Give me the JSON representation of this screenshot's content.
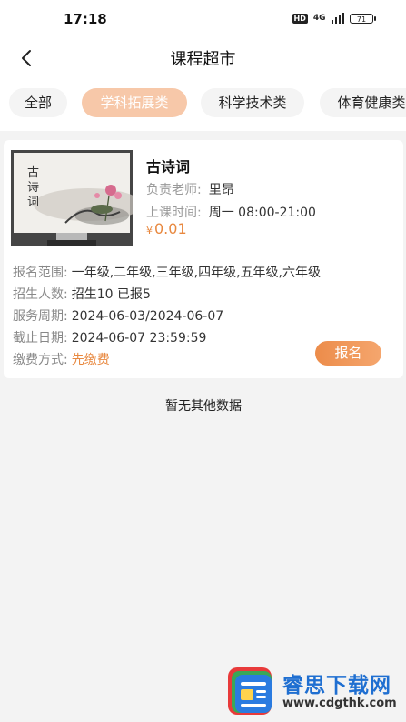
{
  "status_bar": {
    "time": "17:18",
    "network_badge": "HD",
    "wifi_label": "4G",
    "battery": "71"
  },
  "header": {
    "title": "课程超市",
    "back_icon": "chevron-left-icon"
  },
  "tabs": [
    {
      "label": "全部",
      "active": false
    },
    {
      "label": "学科拓展类",
      "active": true
    },
    {
      "label": "科学技术类",
      "active": false
    },
    {
      "label": "体育健康类",
      "active": false
    }
  ],
  "course": {
    "image_text": "古诗词",
    "name": "古诗词",
    "teacher_label": "负责老师:",
    "teacher": "里昂",
    "time_label": "上课时间:",
    "time": "周一 08:00-21:00",
    "price_symbol": "¥",
    "price": "0.01",
    "details": [
      {
        "label": "报名范围:",
        "value": "一年级,二年级,三年级,四年级,五年级,六年级"
      },
      {
        "label": "招生人数:",
        "value": "招生10 已报5"
      },
      {
        "label": "服务周期:",
        "value": "2024-06-03/2024-06-07"
      },
      {
        "label": "截止日期:",
        "value": "2024-06-07 23:59:59"
      },
      {
        "label": "缴费方式:",
        "value": "先缴费"
      }
    ],
    "signup_label": "报名"
  },
  "empty_message": "暂无其他数据",
  "watermark": {
    "title": "睿思下载网",
    "url": "www.cdgthk.com"
  },
  "colors": {
    "accent": "#e8883f",
    "active_tab": "#f7c8a9",
    "watermark_blue": "#1f6fd1"
  }
}
